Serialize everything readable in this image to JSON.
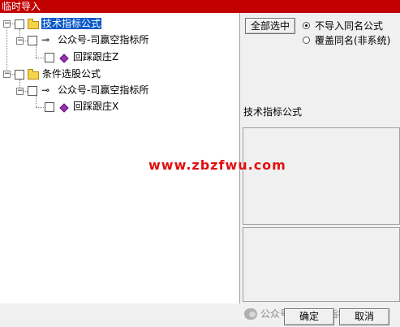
{
  "window": {
    "title": "临时导入"
  },
  "tree": {
    "nodes": [
      {
        "label": "技术指标公式"
      },
      {
        "label": "公众号-司赢空指标所"
      },
      {
        "label": "回踩跟庄Z"
      },
      {
        "label": "条件选股公式"
      },
      {
        "label": "公众号-司赢空指标所"
      },
      {
        "label": "回踩跟庄X"
      }
    ]
  },
  "controls": {
    "select_all_label": "全部选中",
    "options": [
      {
        "label": "不导入同名公式",
        "checked": true
      },
      {
        "label": "覆盖同名(非系统)",
        "checked": false
      }
    ]
  },
  "info": {
    "formula_type": "技术指标公式"
  },
  "watermark": {
    "text": "www.zbzfwu.com"
  },
  "footer": {
    "confirm_label": "确定",
    "cancel_label": "取消",
    "brand_text": "公众号 · 司赢空指标所"
  }
}
